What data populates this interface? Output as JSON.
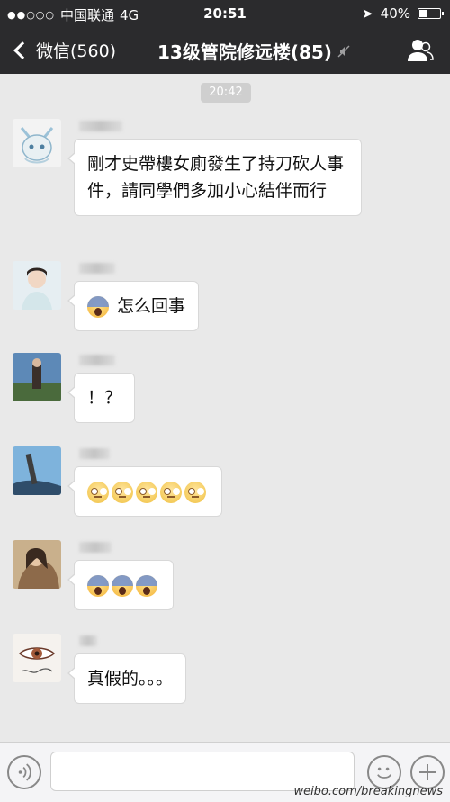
{
  "status_bar": {
    "signal_dots": "●●○○○",
    "carrier": "中国联通",
    "network": "4G",
    "time": "20:51",
    "battery": "40%",
    "battery_level": 0.4
  },
  "nav": {
    "back_label": "微信(560)",
    "title": "13级管院修远楼(85)"
  },
  "chat": {
    "timestamp": "20:42",
    "messages": [
      {
        "text": "剛才史帶樓女廁發生了持刀砍人事件，請同學們多加小心結伴而行",
        "emoji": []
      },
      {
        "text": "怎么回事",
        "emoji": [
          "scream"
        ]
      },
      {
        "text": "！？",
        "emoji": []
      },
      {
        "text": "",
        "emoji": [
          "roll",
          "roll",
          "roll",
          "roll",
          "roll"
        ]
      },
      {
        "text": "",
        "emoji": [
          "scream",
          "scream",
          "scream"
        ]
      },
      {
        "text": "真假的。。。",
        "emoji": []
      }
    ]
  },
  "input": {
    "placeholder": ""
  },
  "watermark": "weibo.com/breakingnews"
}
